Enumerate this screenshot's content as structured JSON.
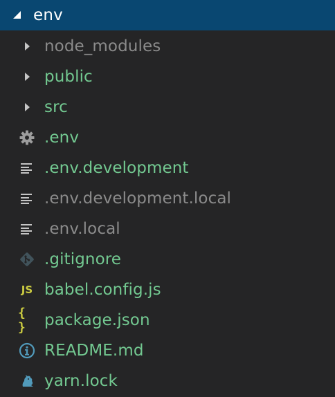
{
  "tree": {
    "root": {
      "label": "env",
      "expanded": true,
      "icon": "chevron-down-icon"
    },
    "items": [
      {
        "label": "node_modules",
        "kind": "folder",
        "icon": "chevron-right-icon",
        "status": "ignored",
        "color": "#8b8b8b"
      },
      {
        "label": "public",
        "kind": "folder",
        "icon": "chevron-right-icon",
        "status": "untracked",
        "color": "#73c991"
      },
      {
        "label": "src",
        "kind": "folder",
        "icon": "chevron-right-icon",
        "status": "untracked",
        "color": "#73c991"
      },
      {
        "label": ".env",
        "kind": "file",
        "icon": "gear-icon",
        "status": "untracked",
        "color": "#73c991"
      },
      {
        "label": ".env.development",
        "kind": "file",
        "icon": "text-file-icon",
        "status": "untracked",
        "color": "#73c991"
      },
      {
        "label": ".env.development.local",
        "kind": "file",
        "icon": "text-file-icon",
        "status": "ignored",
        "color": "#8b8b8b"
      },
      {
        "label": ".env.local",
        "kind": "file",
        "icon": "text-file-icon",
        "status": "ignored",
        "color": "#8b8b8b"
      },
      {
        "label": ".gitignore",
        "kind": "file",
        "icon": "git-icon",
        "status": "untracked",
        "color": "#73c991"
      },
      {
        "label": "babel.config.js",
        "kind": "file",
        "icon": "javascript-icon",
        "icon_text": "JS",
        "status": "untracked",
        "color": "#73c991"
      },
      {
        "label": "package.json",
        "kind": "file",
        "icon": "json-icon",
        "icon_text": "{ }",
        "status": "untracked",
        "color": "#73c991"
      },
      {
        "label": "README.md",
        "kind": "file",
        "icon": "info-icon",
        "status": "untracked",
        "color": "#73c991"
      },
      {
        "label": "yarn.lock",
        "kind": "file",
        "icon": "yarn-icon",
        "status": "untracked",
        "color": "#73c991"
      }
    ]
  },
  "colors": {
    "background": "#252526",
    "selection": "#094771",
    "untracked": "#73c991",
    "ignored": "#8b8b8b",
    "icon_grey": "#9d9d9d",
    "icon_yellow": "#cbcb41",
    "icon_blue": "#519aba"
  }
}
